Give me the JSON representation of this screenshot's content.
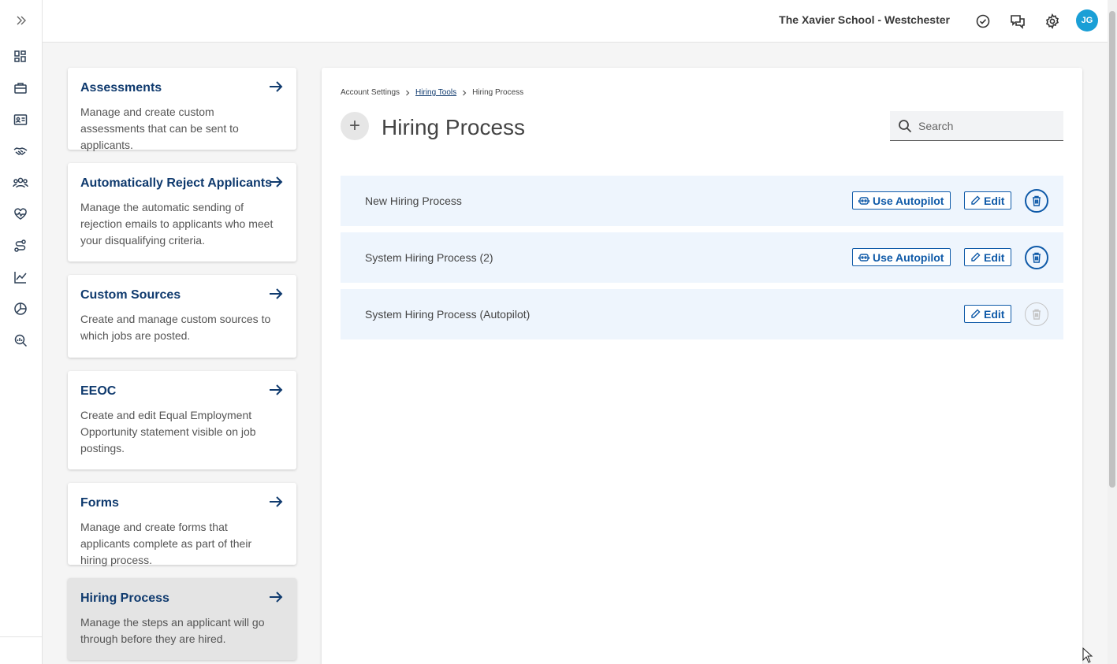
{
  "header": {
    "org_name": "The Xavier School - Westchester",
    "avatar_initials": "JG",
    "avatar_color": "#1a9fd6"
  },
  "sidebar_nav": {
    "icons": [
      "expand-icon",
      "dashboard-icon",
      "briefcase-icon",
      "id-card-icon",
      "handshake-icon",
      "people-icon",
      "heart-pulse-icon",
      "route-icon",
      "line-chart-icon",
      "pie-chart-icon",
      "search-analytics-icon"
    ]
  },
  "settings_cards": [
    {
      "title": "Assessments",
      "description": "Manage and create custom assessments that can be sent to applicants."
    },
    {
      "title": "Automatically Reject Applicants",
      "description": "Manage the automatic sending of rejection emails to applicants who meet your disqualifying criteria."
    },
    {
      "title": "Custom Sources",
      "description": "Create and manage custom sources to which jobs are posted."
    },
    {
      "title": "EEOC",
      "description": "Create and edit Equal Employment Opportunity statement visible on job postings."
    },
    {
      "title": "Forms",
      "description": "Manage and create forms that applicants complete as part of their hiring process."
    },
    {
      "title": "Hiring Process",
      "description": "Manage the steps an applicant will go through before they are hired."
    }
  ],
  "breadcrumb": {
    "root": "Account Settings",
    "parent": "Hiring Tools",
    "current": "Hiring Process"
  },
  "main": {
    "title": "Hiring Process",
    "add_symbol": "+",
    "search_placeholder": "Search"
  },
  "processes": [
    {
      "name": "New Hiring Process",
      "autopilot_label": "Use Autopilot",
      "edit_label": "Edit",
      "deletable": true
    },
    {
      "name": "System Hiring Process (2)",
      "autopilot_label": "Use Autopilot",
      "edit_label": "Edit",
      "deletable": true
    },
    {
      "name": "System Hiring Process (Autopilot)",
      "edit_label": "Edit",
      "deletable": false
    }
  ],
  "colors": {
    "primary": "#0f3a6e",
    "button": "#0f5aa8",
    "row_bg": "#eef5fd"
  }
}
